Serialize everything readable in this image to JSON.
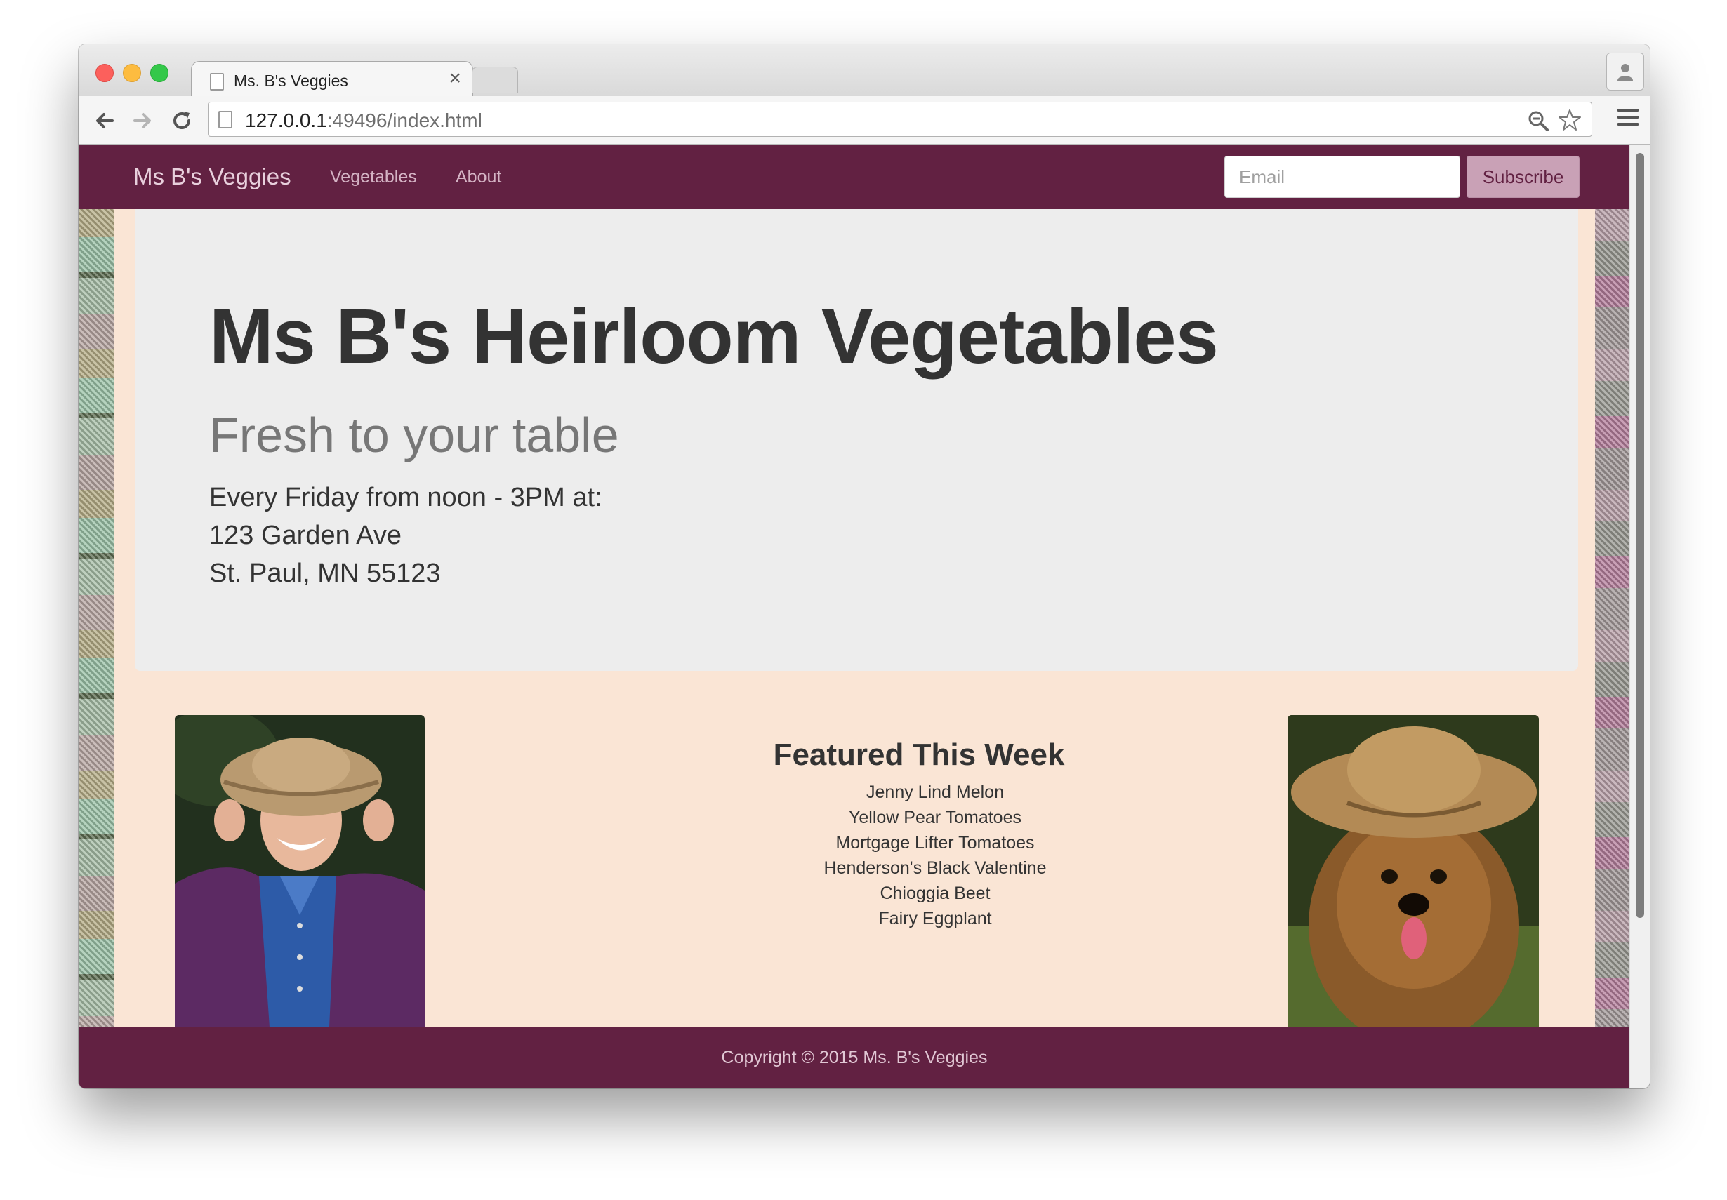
{
  "browser": {
    "tab_title": "Ms. B's Veggies",
    "tab_close": "×",
    "url_host": "127.0.0.1",
    "url_rest": ":49496/index.html"
  },
  "site": {
    "brand": "Ms B's Veggies",
    "nav": [
      "Vegetables",
      "About"
    ],
    "email_placeholder": "Email",
    "subscribe_label": "Subscribe",
    "colors": {
      "nav": "#622142",
      "page_bg": "#fae5d5",
      "jumbotron": "#ededed"
    }
  },
  "jumbotron": {
    "title": "Ms B's Heirloom Vegetables",
    "subtitle": "Fresh to your table",
    "schedule": "Every Friday from noon - 3PM at:",
    "address_line1": "123 Garden Ave",
    "address_line2": "St. Paul, MN 55123"
  },
  "featured": {
    "title": "Featured This Week",
    "items": [
      "Jenny Lind Melon",
      "Yellow Pear Tomatoes",
      "Mortgage Lifter Tomatoes",
      "Henderson's Black Valentine",
      "Chioggia Beet",
      "Fairy Eggplant"
    ]
  },
  "footer": {
    "copyright": "Copyright © 2015 Ms. B's Veggies"
  },
  "icons": [
    "back-arrow-icon",
    "forward-arrow-icon",
    "reload-icon",
    "page-icon",
    "zoom-icon",
    "bookmark-star-icon",
    "menu-icon",
    "profile-icon"
  ]
}
